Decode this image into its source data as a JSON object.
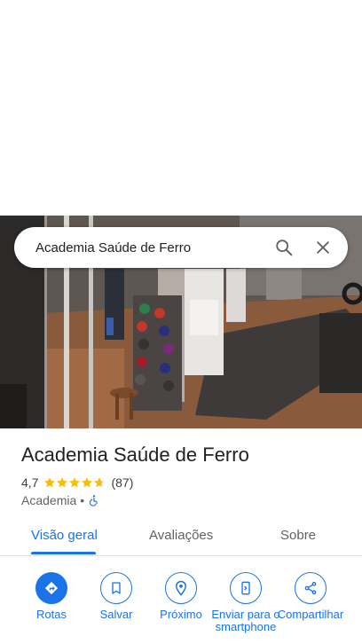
{
  "search": {
    "query": "Academia Saúde de Ferro"
  },
  "place": {
    "name": "Academia Saúde de Ferro",
    "rating": "4,7",
    "rating_value": 4.7,
    "reviews": "(87)",
    "category": "Academia",
    "separator": "•"
  },
  "tabs": [
    {
      "label": "Visão geral",
      "active": true
    },
    {
      "label": "Avaliações",
      "active": false
    },
    {
      "label": "Sobre",
      "active": false
    }
  ],
  "actions": [
    {
      "label": "Rotas",
      "icon": "directions-icon"
    },
    {
      "label": "Salvar",
      "icon": "bookmark-icon"
    },
    {
      "label": "Próximo",
      "icon": "nearby-icon"
    },
    {
      "label": "Enviar para o smartphone",
      "icon": "send-to-phone-icon"
    },
    {
      "label": "Compartilhar",
      "icon": "share-icon"
    }
  ],
  "colors": {
    "accent": "#1a73e8",
    "star": "#fbbc04",
    "text": "#202124",
    "secondary": "#5f6368"
  }
}
